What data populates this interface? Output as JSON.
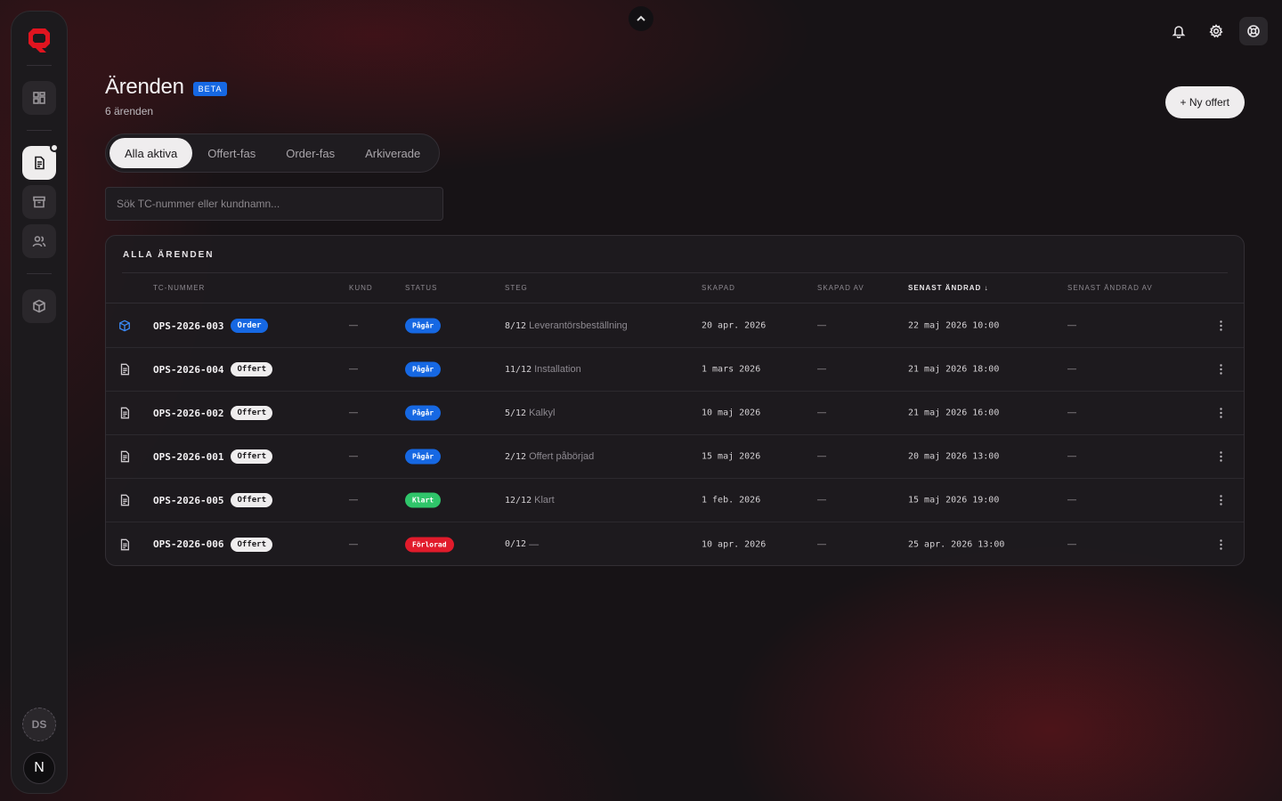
{
  "sidebar": {
    "user_initials": "DS",
    "n_badge": "N"
  },
  "header": {
    "title": "Ärenden",
    "beta": "BETA",
    "subtitle": "6 ärenden",
    "new_button": "+ Ny offert"
  },
  "tabs": [
    {
      "label": "Alla aktiva",
      "active": true
    },
    {
      "label": "Offert-fas",
      "active": false
    },
    {
      "label": "Order-fas",
      "active": false
    },
    {
      "label": "Arkiverade",
      "active": false
    }
  ],
  "search": {
    "placeholder": "Sök TC-nummer eller kundnamn..."
  },
  "table": {
    "title": "ALLA ÄRENDEN",
    "columns": {
      "tc": "TC-NUMMER",
      "kund": "KUND",
      "status": "STATUS",
      "steg": "STEG",
      "skapad": "SKAPAD",
      "skapad_av": "SKAPAD AV",
      "senast_andrad": "SENAST ÄNDRAD",
      "senast_andrad_av": "SENAST ÄNDRAD AV"
    },
    "rows": [
      {
        "icon": "box-icon",
        "tc": "OPS-2026-003",
        "phase": "Order",
        "kund": "—",
        "status": "Pågår",
        "status_color": "#1668e3",
        "step": "8/12",
        "step_label": "Leverantörsbeställning",
        "skapad": "20 apr. 2026",
        "skapad_av": "—",
        "senast": "22 maj 2026 10:00",
        "senast_av": "—"
      },
      {
        "icon": "document-icon",
        "tc": "OPS-2026-004",
        "phase": "Offert",
        "kund": "—",
        "status": "Pågår",
        "status_color": "#1668e3",
        "step": "11/12",
        "step_label": "Installation",
        "skapad": "1 mars 2026",
        "skapad_av": "—",
        "senast": "21 maj 2026 18:00",
        "senast_av": "—"
      },
      {
        "icon": "document-icon",
        "tc": "OPS-2026-002",
        "phase": "Offert",
        "kund": "—",
        "status": "Pågår",
        "status_color": "#1668e3",
        "step": "5/12",
        "step_label": "Kalkyl",
        "skapad": "10 maj 2026",
        "skapad_av": "—",
        "senast": "21 maj 2026 16:00",
        "senast_av": "—"
      },
      {
        "icon": "document-icon",
        "tc": "OPS-2026-001",
        "phase": "Offert",
        "kund": "—",
        "status": "Pågår",
        "status_color": "#1668e3",
        "step": "2/12",
        "step_label": "Offert påbörjad",
        "skapad": "15 maj 2026",
        "skapad_av": "—",
        "senast": "20 maj 2026 13:00",
        "senast_av": "—"
      },
      {
        "icon": "document-icon",
        "tc": "OPS-2026-005",
        "phase": "Offert",
        "kund": "—",
        "status": "Klart",
        "status_color": "#2fc56a",
        "step": "12/12",
        "step_label": "Klart",
        "skapad": "1 feb. 2026",
        "skapad_av": "—",
        "senast": "15 maj 2026 19:00",
        "senast_av": "—"
      },
      {
        "icon": "document-icon",
        "tc": "OPS-2026-006",
        "phase": "Offert",
        "kund": "—",
        "status": "Förlorad",
        "status_color": "#e11b2b",
        "step": "0/12",
        "step_label": "—",
        "skapad": "10 apr. 2026",
        "skapad_av": "—",
        "senast": "25 apr. 2026 13:00",
        "senast_av": "—"
      }
    ]
  },
  "colors": {
    "accent": "#1668e3",
    "brand": "#e11b2b",
    "success": "#2fc56a"
  }
}
